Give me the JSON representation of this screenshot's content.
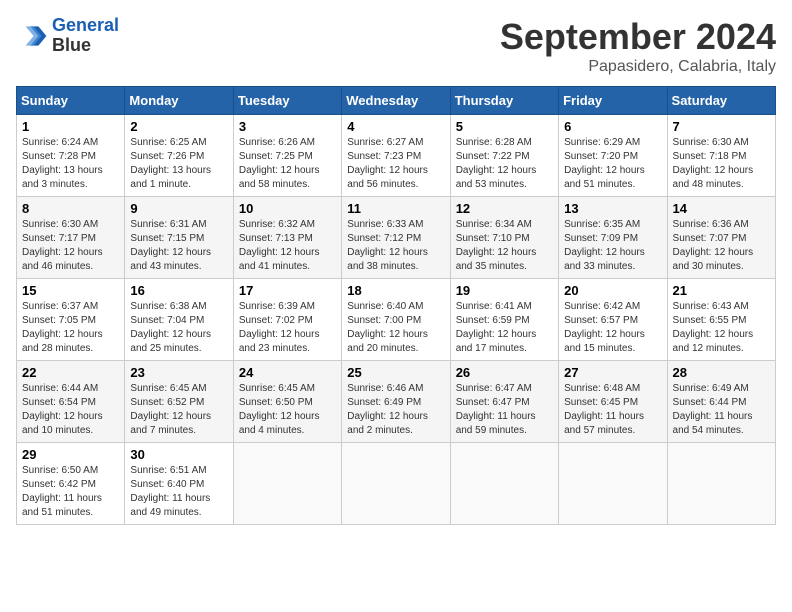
{
  "header": {
    "logo_line1": "General",
    "logo_line2": "Blue",
    "month": "September 2024",
    "location": "Papasidero, Calabria, Italy"
  },
  "days_of_week": [
    "Sunday",
    "Monday",
    "Tuesday",
    "Wednesday",
    "Thursday",
    "Friday",
    "Saturday"
  ],
  "weeks": [
    [
      {
        "day": "1",
        "info": "Sunrise: 6:24 AM\nSunset: 7:28 PM\nDaylight: 13 hours\nand 3 minutes."
      },
      {
        "day": "2",
        "info": "Sunrise: 6:25 AM\nSunset: 7:26 PM\nDaylight: 13 hours\nand 1 minute."
      },
      {
        "day": "3",
        "info": "Sunrise: 6:26 AM\nSunset: 7:25 PM\nDaylight: 12 hours\nand 58 minutes."
      },
      {
        "day": "4",
        "info": "Sunrise: 6:27 AM\nSunset: 7:23 PM\nDaylight: 12 hours\nand 56 minutes."
      },
      {
        "day": "5",
        "info": "Sunrise: 6:28 AM\nSunset: 7:22 PM\nDaylight: 12 hours\nand 53 minutes."
      },
      {
        "day": "6",
        "info": "Sunrise: 6:29 AM\nSunset: 7:20 PM\nDaylight: 12 hours\nand 51 minutes."
      },
      {
        "day": "7",
        "info": "Sunrise: 6:30 AM\nSunset: 7:18 PM\nDaylight: 12 hours\nand 48 minutes."
      }
    ],
    [
      {
        "day": "8",
        "info": "Sunrise: 6:30 AM\nSunset: 7:17 PM\nDaylight: 12 hours\nand 46 minutes."
      },
      {
        "day": "9",
        "info": "Sunrise: 6:31 AM\nSunset: 7:15 PM\nDaylight: 12 hours\nand 43 minutes."
      },
      {
        "day": "10",
        "info": "Sunrise: 6:32 AM\nSunset: 7:13 PM\nDaylight: 12 hours\nand 41 minutes."
      },
      {
        "day": "11",
        "info": "Sunrise: 6:33 AM\nSunset: 7:12 PM\nDaylight: 12 hours\nand 38 minutes."
      },
      {
        "day": "12",
        "info": "Sunrise: 6:34 AM\nSunset: 7:10 PM\nDaylight: 12 hours\nand 35 minutes."
      },
      {
        "day": "13",
        "info": "Sunrise: 6:35 AM\nSunset: 7:09 PM\nDaylight: 12 hours\nand 33 minutes."
      },
      {
        "day": "14",
        "info": "Sunrise: 6:36 AM\nSunset: 7:07 PM\nDaylight: 12 hours\nand 30 minutes."
      }
    ],
    [
      {
        "day": "15",
        "info": "Sunrise: 6:37 AM\nSunset: 7:05 PM\nDaylight: 12 hours\nand 28 minutes."
      },
      {
        "day": "16",
        "info": "Sunrise: 6:38 AM\nSunset: 7:04 PM\nDaylight: 12 hours\nand 25 minutes."
      },
      {
        "day": "17",
        "info": "Sunrise: 6:39 AM\nSunset: 7:02 PM\nDaylight: 12 hours\nand 23 minutes."
      },
      {
        "day": "18",
        "info": "Sunrise: 6:40 AM\nSunset: 7:00 PM\nDaylight: 12 hours\nand 20 minutes."
      },
      {
        "day": "19",
        "info": "Sunrise: 6:41 AM\nSunset: 6:59 PM\nDaylight: 12 hours\nand 17 minutes."
      },
      {
        "day": "20",
        "info": "Sunrise: 6:42 AM\nSunset: 6:57 PM\nDaylight: 12 hours\nand 15 minutes."
      },
      {
        "day": "21",
        "info": "Sunrise: 6:43 AM\nSunset: 6:55 PM\nDaylight: 12 hours\nand 12 minutes."
      }
    ],
    [
      {
        "day": "22",
        "info": "Sunrise: 6:44 AM\nSunset: 6:54 PM\nDaylight: 12 hours\nand 10 minutes."
      },
      {
        "day": "23",
        "info": "Sunrise: 6:45 AM\nSunset: 6:52 PM\nDaylight: 12 hours\nand 7 minutes."
      },
      {
        "day": "24",
        "info": "Sunrise: 6:45 AM\nSunset: 6:50 PM\nDaylight: 12 hours\nand 4 minutes."
      },
      {
        "day": "25",
        "info": "Sunrise: 6:46 AM\nSunset: 6:49 PM\nDaylight: 12 hours\nand 2 minutes."
      },
      {
        "day": "26",
        "info": "Sunrise: 6:47 AM\nSunset: 6:47 PM\nDaylight: 11 hours\nand 59 minutes."
      },
      {
        "day": "27",
        "info": "Sunrise: 6:48 AM\nSunset: 6:45 PM\nDaylight: 11 hours\nand 57 minutes."
      },
      {
        "day": "28",
        "info": "Sunrise: 6:49 AM\nSunset: 6:44 PM\nDaylight: 11 hours\nand 54 minutes."
      }
    ],
    [
      {
        "day": "29",
        "info": "Sunrise: 6:50 AM\nSunset: 6:42 PM\nDaylight: 11 hours\nand 51 minutes."
      },
      {
        "day": "30",
        "info": "Sunrise: 6:51 AM\nSunset: 6:40 PM\nDaylight: 11 hours\nand 49 minutes."
      },
      {
        "day": "",
        "info": ""
      },
      {
        "day": "",
        "info": ""
      },
      {
        "day": "",
        "info": ""
      },
      {
        "day": "",
        "info": ""
      },
      {
        "day": "",
        "info": ""
      }
    ]
  ]
}
